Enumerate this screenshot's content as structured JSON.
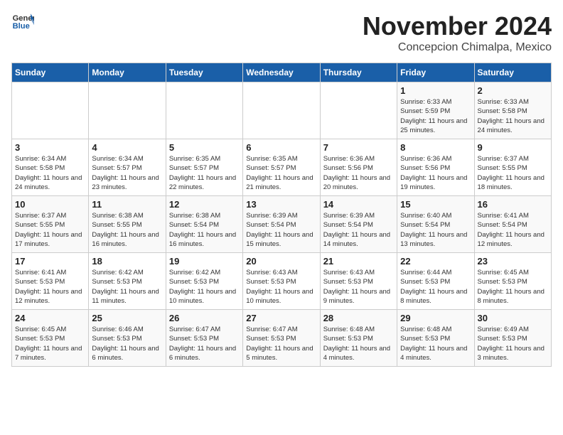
{
  "header": {
    "logo_general": "General",
    "logo_blue": "Blue",
    "month_title": "November 2024",
    "location": "Concepcion Chimalpa, Mexico"
  },
  "days_of_week": [
    "Sunday",
    "Monday",
    "Tuesday",
    "Wednesday",
    "Thursday",
    "Friday",
    "Saturday"
  ],
  "weeks": [
    [
      {
        "day": "",
        "info": ""
      },
      {
        "day": "",
        "info": ""
      },
      {
        "day": "",
        "info": ""
      },
      {
        "day": "",
        "info": ""
      },
      {
        "day": "",
        "info": ""
      },
      {
        "day": "1",
        "info": "Sunrise: 6:33 AM\nSunset: 5:59 PM\nDaylight: 11 hours and 25 minutes."
      },
      {
        "day": "2",
        "info": "Sunrise: 6:33 AM\nSunset: 5:58 PM\nDaylight: 11 hours and 24 minutes."
      }
    ],
    [
      {
        "day": "3",
        "info": "Sunrise: 6:34 AM\nSunset: 5:58 PM\nDaylight: 11 hours and 24 minutes."
      },
      {
        "day": "4",
        "info": "Sunrise: 6:34 AM\nSunset: 5:57 PM\nDaylight: 11 hours and 23 minutes."
      },
      {
        "day": "5",
        "info": "Sunrise: 6:35 AM\nSunset: 5:57 PM\nDaylight: 11 hours and 22 minutes."
      },
      {
        "day": "6",
        "info": "Sunrise: 6:35 AM\nSunset: 5:57 PM\nDaylight: 11 hours and 21 minutes."
      },
      {
        "day": "7",
        "info": "Sunrise: 6:36 AM\nSunset: 5:56 PM\nDaylight: 11 hours and 20 minutes."
      },
      {
        "day": "8",
        "info": "Sunrise: 6:36 AM\nSunset: 5:56 PM\nDaylight: 11 hours and 19 minutes."
      },
      {
        "day": "9",
        "info": "Sunrise: 6:37 AM\nSunset: 5:55 PM\nDaylight: 11 hours and 18 minutes."
      }
    ],
    [
      {
        "day": "10",
        "info": "Sunrise: 6:37 AM\nSunset: 5:55 PM\nDaylight: 11 hours and 17 minutes."
      },
      {
        "day": "11",
        "info": "Sunrise: 6:38 AM\nSunset: 5:55 PM\nDaylight: 11 hours and 16 minutes."
      },
      {
        "day": "12",
        "info": "Sunrise: 6:38 AM\nSunset: 5:54 PM\nDaylight: 11 hours and 16 minutes."
      },
      {
        "day": "13",
        "info": "Sunrise: 6:39 AM\nSunset: 5:54 PM\nDaylight: 11 hours and 15 minutes."
      },
      {
        "day": "14",
        "info": "Sunrise: 6:39 AM\nSunset: 5:54 PM\nDaylight: 11 hours and 14 minutes."
      },
      {
        "day": "15",
        "info": "Sunrise: 6:40 AM\nSunset: 5:54 PM\nDaylight: 11 hours and 13 minutes."
      },
      {
        "day": "16",
        "info": "Sunrise: 6:41 AM\nSunset: 5:54 PM\nDaylight: 11 hours and 12 minutes."
      }
    ],
    [
      {
        "day": "17",
        "info": "Sunrise: 6:41 AM\nSunset: 5:53 PM\nDaylight: 11 hours and 12 minutes."
      },
      {
        "day": "18",
        "info": "Sunrise: 6:42 AM\nSunset: 5:53 PM\nDaylight: 11 hours and 11 minutes."
      },
      {
        "day": "19",
        "info": "Sunrise: 6:42 AM\nSunset: 5:53 PM\nDaylight: 11 hours and 10 minutes."
      },
      {
        "day": "20",
        "info": "Sunrise: 6:43 AM\nSunset: 5:53 PM\nDaylight: 11 hours and 10 minutes."
      },
      {
        "day": "21",
        "info": "Sunrise: 6:43 AM\nSunset: 5:53 PM\nDaylight: 11 hours and 9 minutes."
      },
      {
        "day": "22",
        "info": "Sunrise: 6:44 AM\nSunset: 5:53 PM\nDaylight: 11 hours and 8 minutes."
      },
      {
        "day": "23",
        "info": "Sunrise: 6:45 AM\nSunset: 5:53 PM\nDaylight: 11 hours and 8 minutes."
      }
    ],
    [
      {
        "day": "24",
        "info": "Sunrise: 6:45 AM\nSunset: 5:53 PM\nDaylight: 11 hours and 7 minutes."
      },
      {
        "day": "25",
        "info": "Sunrise: 6:46 AM\nSunset: 5:53 PM\nDaylight: 11 hours and 6 minutes."
      },
      {
        "day": "26",
        "info": "Sunrise: 6:47 AM\nSunset: 5:53 PM\nDaylight: 11 hours and 6 minutes."
      },
      {
        "day": "27",
        "info": "Sunrise: 6:47 AM\nSunset: 5:53 PM\nDaylight: 11 hours and 5 minutes."
      },
      {
        "day": "28",
        "info": "Sunrise: 6:48 AM\nSunset: 5:53 PM\nDaylight: 11 hours and 4 minutes."
      },
      {
        "day": "29",
        "info": "Sunrise: 6:48 AM\nSunset: 5:53 PM\nDaylight: 11 hours and 4 minutes."
      },
      {
        "day": "30",
        "info": "Sunrise: 6:49 AM\nSunset: 5:53 PM\nDaylight: 11 hours and 3 minutes."
      }
    ]
  ]
}
